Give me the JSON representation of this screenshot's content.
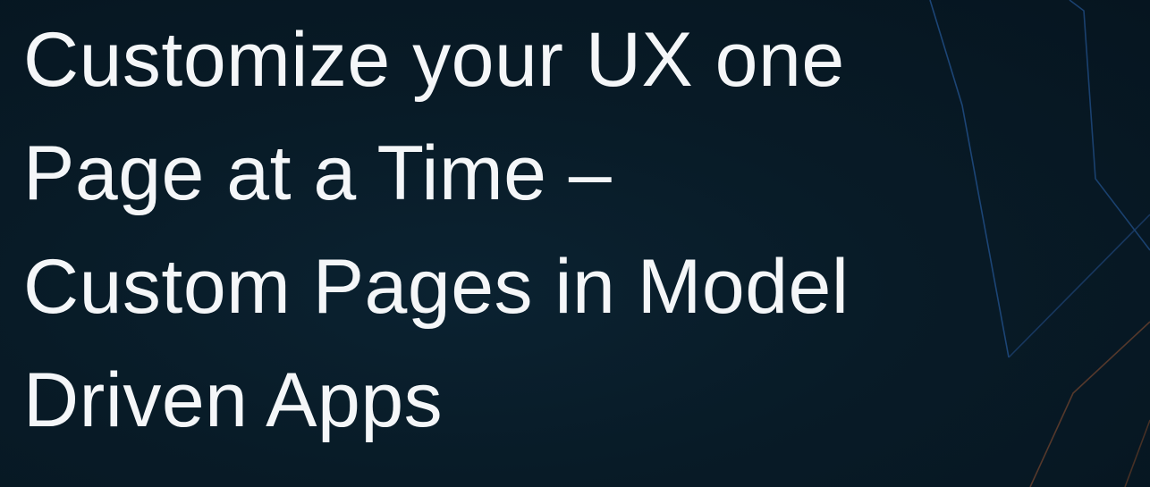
{
  "title_lines": [
    "Customize your UX one",
    "Page at a Time –",
    "Custom Pages in Model",
    "Driven Apps"
  ],
  "colors": {
    "background": "#081b27",
    "text": "#f4f6f8",
    "accent_line_blue": "#1f4f8a",
    "accent_line_brown": "#5a3a2c"
  }
}
